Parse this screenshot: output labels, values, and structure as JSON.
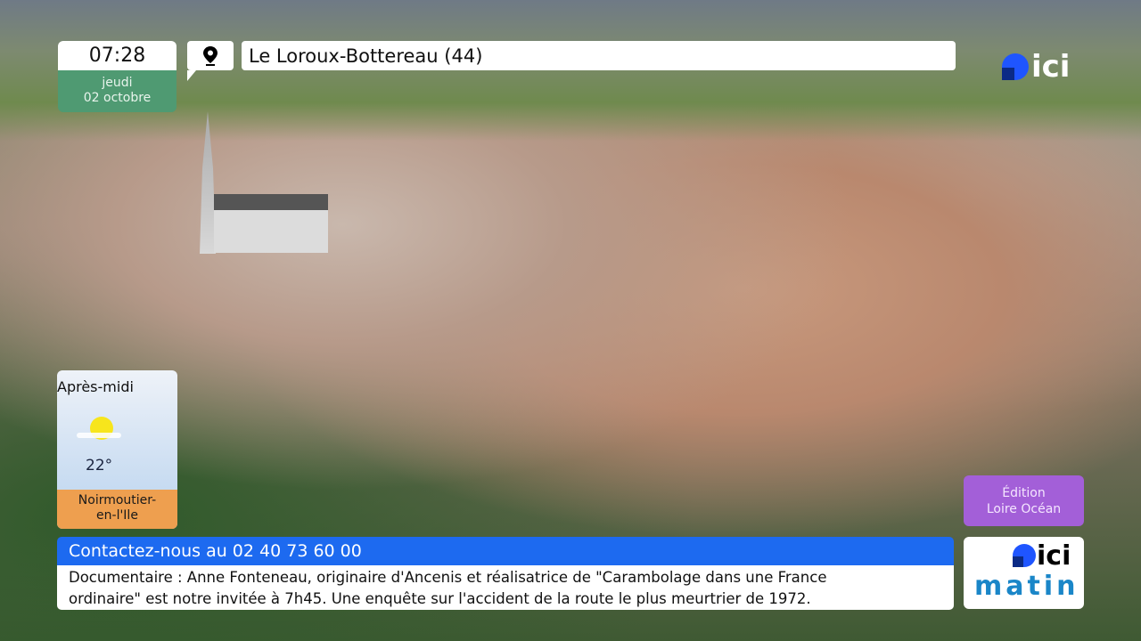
{
  "clock": {
    "time": "07:28",
    "day": "jeudi",
    "date": "02 octobre"
  },
  "location": {
    "icon": "map-pin-icon",
    "name": "Le Loroux-Bottereau (44)"
  },
  "channel_logo": "ici",
  "weather": {
    "period": "Après-midi",
    "icon": "sun-cloud-icon",
    "temperature": "22°",
    "city_line1": "Noirmoutier-",
    "city_line2": "en-l'Ile"
  },
  "edition": {
    "line1": "Édition",
    "line2": "Loire Océan"
  },
  "show_logo": {
    "brand": "ici",
    "name": "matin"
  },
  "ticker": {
    "headline": "Contactez-nous au 02 40 73 60 00",
    "line1": "Documentaire : Anne Fonteneau, originaire d'Ancenis et réalisatrice de \"Carambolage dans une France",
    "line2": "ordinaire\" est notre invitée à 7h45. Une enquête sur l'accident de la route le plus meurtrier de 1972."
  },
  "colors": {
    "clock_green": "#4f9a72",
    "ticker_blue": "#1d6af0",
    "edition_purple": "#a35fd8",
    "city_orange": "#ee9f4f"
  }
}
